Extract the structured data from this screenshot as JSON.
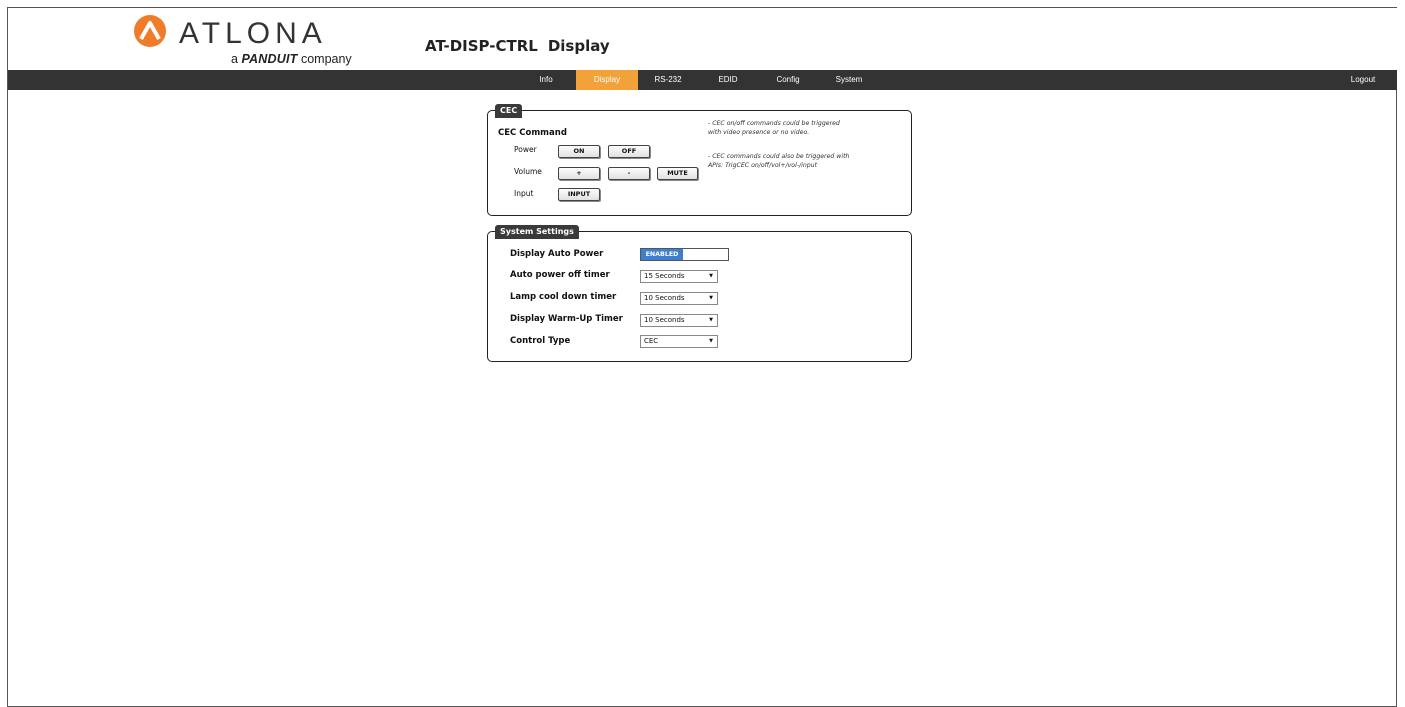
{
  "brand": {
    "name": "ATLONA",
    "tagline_prefix": "a",
    "tagline_brand": "PANDUIT",
    "tagline_suffix": "company"
  },
  "header": {
    "model": "AT-DISP-CTRL",
    "page": "Display"
  },
  "nav": {
    "tabs": [
      "Info",
      "Display",
      "RS-232",
      "EDID",
      "Config",
      "System"
    ],
    "active": "Display",
    "logout": "Logout"
  },
  "cec": {
    "legend": "CEC",
    "heading": "CEC Command",
    "power_label": "Power",
    "power_on": "ON",
    "power_off": "OFF",
    "volume_label": "Volume",
    "vol_up": "+",
    "vol_down": "-",
    "mute": "MUTE",
    "input_label": "Input",
    "input_btn": "INPUT",
    "note1_line1": "- CEC on/off commands could be triggered",
    "note1_line2": "with video presence or no video.",
    "note2_line1": "- CEC commands could also be triggered with",
    "note2_line2": "APIs: TrigCEC on/off/vol+/vol-/input"
  },
  "system_settings": {
    "legend": "System Settings",
    "display_auto_power_label": "Display Auto Power",
    "display_auto_power_value": "ENABLED",
    "auto_power_off_label": "Auto power off timer",
    "auto_power_off_value": "15 Seconds",
    "lamp_cool_label": "Lamp cool down timer",
    "lamp_cool_value": "10 Seconds",
    "warm_up_label": "Display Warm-Up Timer",
    "warm_up_value": "10 Seconds",
    "control_type_label": "Control Type",
    "control_type_value": "CEC"
  },
  "colors": {
    "nav_bg": "#333333",
    "nav_active": "#f3a23a",
    "logo_orange": "#f07c2a",
    "toggle_blue": "#3c7fd0"
  }
}
